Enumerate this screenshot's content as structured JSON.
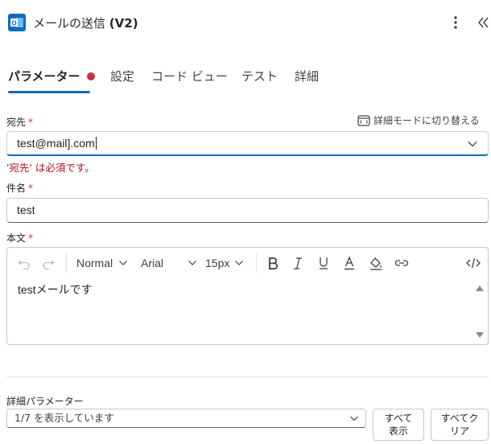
{
  "header": {
    "title": "メールの送信",
    "title_version": "(V2)",
    "icon": "outlook-icon",
    "icon_letter": "O",
    "menu_icon": "more-vertical-icon",
    "collapse_icon": "double-chevron-left-icon"
  },
  "tabs": [
    {
      "label": "パラメーター",
      "active": true,
      "error_dot": true
    },
    {
      "label": "設定"
    },
    {
      "label": "コード ビュー"
    },
    {
      "label": "テスト"
    },
    {
      "label": "詳細"
    }
  ],
  "colors": {
    "accent": "#0f6cbd",
    "error": "#b10e1c",
    "required": "#c4314b",
    "outlook_blue": "#0f6cbd"
  },
  "form": {
    "switch_mode_label": "詳細モードに切り替える",
    "to": {
      "label": "宛先",
      "required_mark": "*",
      "value": "test@mail].com",
      "error": "'宛先' は必須です。"
    },
    "subject": {
      "label": "件名",
      "required_mark": "*",
      "value": "test"
    },
    "body": {
      "label": "本文",
      "required_mark": "*",
      "value": "testメールです",
      "toolbar": {
        "format": "Normal",
        "font": "Arial",
        "size": "15px"
      }
    }
  },
  "advanced": {
    "label": "詳細パラメーター",
    "select_value": "1/7 を表示しています",
    "show_all_line1": "すべて",
    "show_all_line2": "表示",
    "clear_all_line1": "すべてク",
    "clear_all_line2": "リア"
  }
}
